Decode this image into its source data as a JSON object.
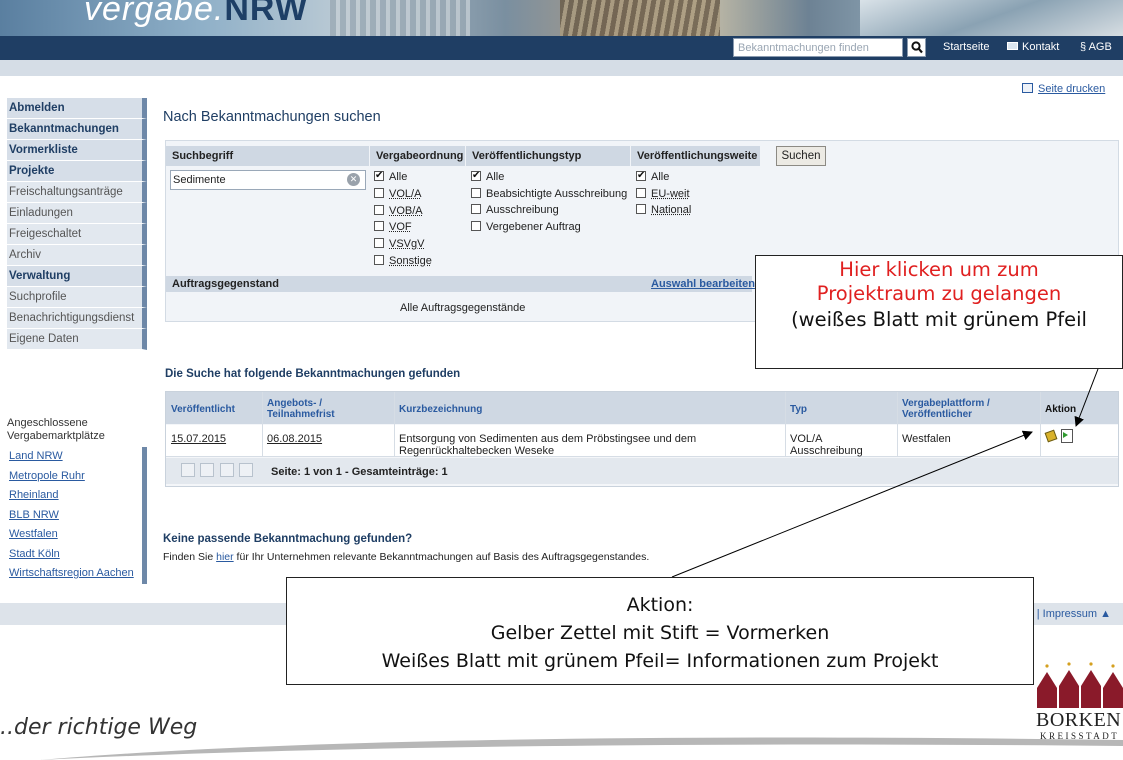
{
  "header": {
    "logo_text": "vergabe.",
    "logo_bold": "NRW",
    "search_placeholder": "Bekanntmachungen finden",
    "links": [
      "Startseite",
      "Kontakt",
      "§ AGB"
    ]
  },
  "print_label": "Seite drucken",
  "nav": {
    "items": [
      {
        "label": "Abmelden",
        "bold": true
      },
      {
        "label": "Bekanntmachungen",
        "bold": true
      },
      {
        "label": "Vormerkliste",
        "bold": true
      },
      {
        "label": "Projekte",
        "bold": true
      },
      {
        "label": "Freischaltungsanträge",
        "bold": false
      },
      {
        "label": "Einladungen",
        "bold": false
      },
      {
        "label": "Freigeschaltet",
        "bold": false
      },
      {
        "label": "Archiv",
        "bold": false
      },
      {
        "label": "Verwaltung",
        "bold": true
      },
      {
        "label": "Suchprofile",
        "bold": false
      },
      {
        "label": "Benachrichtigungsdienst",
        "bold": false
      },
      {
        "label": "Eigene Daten",
        "bold": false
      }
    ],
    "markets_title_1": "Angeschlossene",
    "markets_title_2": "Vergabemarktplätze",
    "markets": [
      "Land NRW",
      "Metropole Ruhr",
      "Rheinland",
      "BLB NRW",
      "Westfalen",
      "Stadt Köln",
      "Wirtschaftsregion Aachen"
    ]
  },
  "search": {
    "title": "Nach Bekanntmachungen suchen",
    "term_header": "Suchbegriff",
    "term_value": "Sedimente",
    "order_header": "Vergabeordnung",
    "order_options": [
      {
        "label": "Alle",
        "checked": true
      },
      {
        "label": "VOL/A",
        "checked": false
      },
      {
        "label": "VOB/A",
        "checked": false
      },
      {
        "label": "VOF",
        "checked": false
      },
      {
        "label": "VSVgV",
        "checked": false
      },
      {
        "label": "Sonstige",
        "checked": false
      }
    ],
    "type_header": "Veröffentlichungstyp",
    "type_options": [
      {
        "label": "Alle",
        "checked": true
      },
      {
        "label": "Beabsichtigte Ausschreibung",
        "checked": false
      },
      {
        "label": "Ausschreibung",
        "checked": false
      },
      {
        "label": "Vergebener Auftrag",
        "checked": false
      }
    ],
    "scope_header": "Veröffentlichungsweite",
    "scope_options": [
      {
        "label": "Alle",
        "checked": true
      },
      {
        "label": "EU-weit",
        "checked": false
      },
      {
        "label": "National",
        "checked": false
      }
    ],
    "submit_label": "Suchen",
    "subject_header": "Auftragsgegenstand",
    "subject_edit": "Auswahl bearbeiten",
    "subject_value": "Alle Auftragsgegenstände"
  },
  "results": {
    "title": "Die Suche hat folgende Bekanntmachungen gefunden",
    "headers": {
      "published": "Veröffentlicht",
      "deadline_1": "Angebots- /",
      "deadline_2": "Teilnahmefrist",
      "short": "Kurzbezeichnung",
      "type": "Typ",
      "platform_1": "Vergabeplattform /",
      "platform_2": "Veröffentlicher",
      "action": "Aktion"
    },
    "row": {
      "published": "15.07.2015",
      "deadline": "06.08.2015",
      "short_1": "Entsorgung von Sedimenten aus dem Pröbstingsee und dem",
      "short_2": "Regenrückhaltebecken Weseke",
      "type_1": "VOL/A",
      "type_2": "Ausschreibung",
      "platform": "Westfalen"
    },
    "pager_text": "Seite: 1 von 1 - Gesamteinträge: 1"
  },
  "nomatch": {
    "title": "Keine passende Bekanntmachung gefunden?",
    "text_before": "Finden Sie ",
    "link": "hier",
    "text_after": " für Ihr Unternehmen relevante Bekanntmachungen auf Basis des Auftragsgegenstandes."
  },
  "footer_link": "r | Impressum  ▲",
  "callout_project": {
    "line1": "Hier klicken um zum",
    "line2": "Projektraum zu gelangen",
    "line3": "(weißes Blatt mit grünem Pfeil"
  },
  "callout_action": {
    "line1": "Aktion:",
    "line2": "Gelber Zettel mit Stift = Vormerken",
    "line3": "Weißes Blatt mit grünem Pfeil= Informationen zum Projekt"
  },
  "slogan": "..der richtige Weg",
  "brand": {
    "name": "BORKEN",
    "sub": "KREISSTADT"
  },
  "colors": {
    "navy": "#1f3e64",
    "link": "#2a5aa0",
    "callout_red": "#e02020"
  }
}
